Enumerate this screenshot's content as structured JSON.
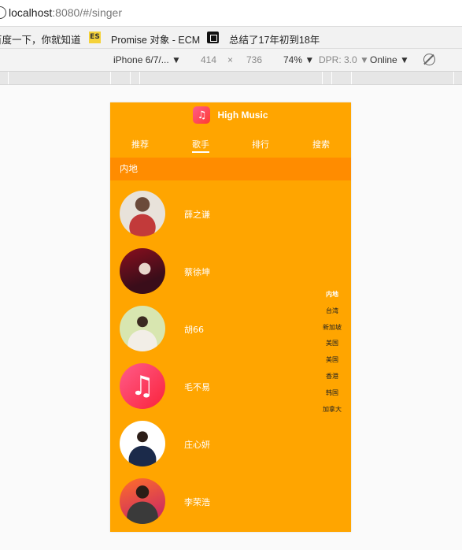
{
  "browser": {
    "url_host": "localhost",
    "url_rest": ":8080/#/singer",
    "bookmarks": [
      {
        "label": "百度一下，你就知道"
      },
      {
        "label": "Promise 对象 - ECM"
      },
      {
        "label": "总结了17年初到18年"
      }
    ],
    "es_icon_text": "ES",
    "devtools": {
      "device": "iPhone 6/7/...",
      "width": "414",
      "times": "×",
      "height": "736",
      "zoom": "74%",
      "dpr": "DPR: 3.0",
      "network": "Online"
    }
  },
  "app": {
    "title": "High Music",
    "logo_glyph": "♫",
    "tabs": [
      {
        "label": "推荐"
      },
      {
        "label": "歌手"
      },
      {
        "label": "排行"
      },
      {
        "label": "搜索"
      }
    ],
    "active_tab": "歌手",
    "group_title": "内地",
    "singers": [
      {
        "name": "薛之谦"
      },
      {
        "name": "蔡徐坤"
      },
      {
        "name": "胡66"
      },
      {
        "name": "毛不易"
      },
      {
        "name": "庄心妍"
      },
      {
        "name": "李荣浩"
      }
    ],
    "shortcut_list": [
      "内地",
      "台湾",
      "新加坡",
      "美国",
      "美国",
      "香港",
      "韩国",
      "加拿大"
    ]
  },
  "colors": {
    "app_background": "#ffa500",
    "group_title_background": "#ff8c00"
  }
}
